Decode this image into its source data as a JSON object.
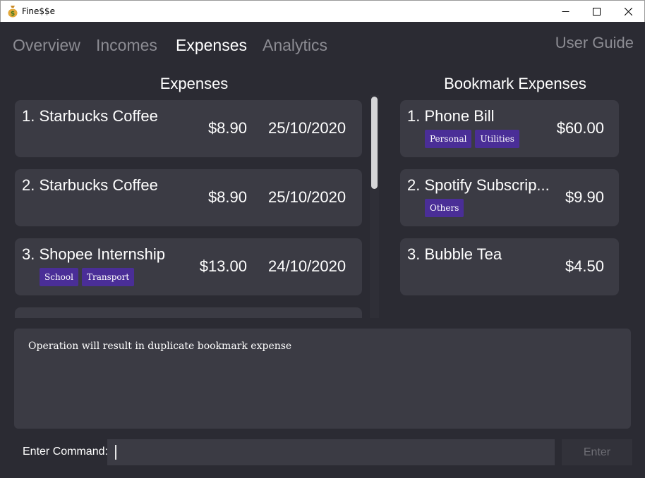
{
  "window": {
    "title": "Fine$$e",
    "icon": "money-bag-icon"
  },
  "tabs": [
    {
      "label": "Overview",
      "active": false
    },
    {
      "label": "Incomes",
      "active": false
    },
    {
      "label": "Expenses",
      "active": true
    },
    {
      "label": "Analytics",
      "active": false
    }
  ],
  "user_guide": "User Guide",
  "expenses": {
    "title": "Expenses",
    "items": [
      {
        "name": "1. Starbucks Coffee",
        "amount": "$8.90",
        "date": "25/10/2020",
        "tags": []
      },
      {
        "name": "2. Starbucks Coffee",
        "amount": "$8.90",
        "date": "25/10/2020",
        "tags": []
      },
      {
        "name": "3. Shopee Internship",
        "amount": "$13.00",
        "date": "24/10/2020",
        "tags": [
          "School",
          "Transport"
        ]
      }
    ]
  },
  "bookmarks": {
    "title": "Bookmark Expenses",
    "items": [
      {
        "name": "1. Phone Bill",
        "amount": "$60.00",
        "tags": [
          "Personal",
          "Utilities"
        ]
      },
      {
        "name": "2. Spotify Subscrip...",
        "amount": "$9.90",
        "tags": [
          "Others"
        ]
      },
      {
        "name": "3. Bubble Tea",
        "amount": "$4.50",
        "tags": []
      }
    ]
  },
  "result": {
    "message": "Operation will result in duplicate bookmark expense"
  },
  "command": {
    "label": "Enter Command:",
    "value": "",
    "button": "Enter"
  },
  "colors": {
    "background": "#2b2b33",
    "card": "#3b3b44",
    "tag": "#4a2e97",
    "inactive_tab": "#8c8c93"
  }
}
